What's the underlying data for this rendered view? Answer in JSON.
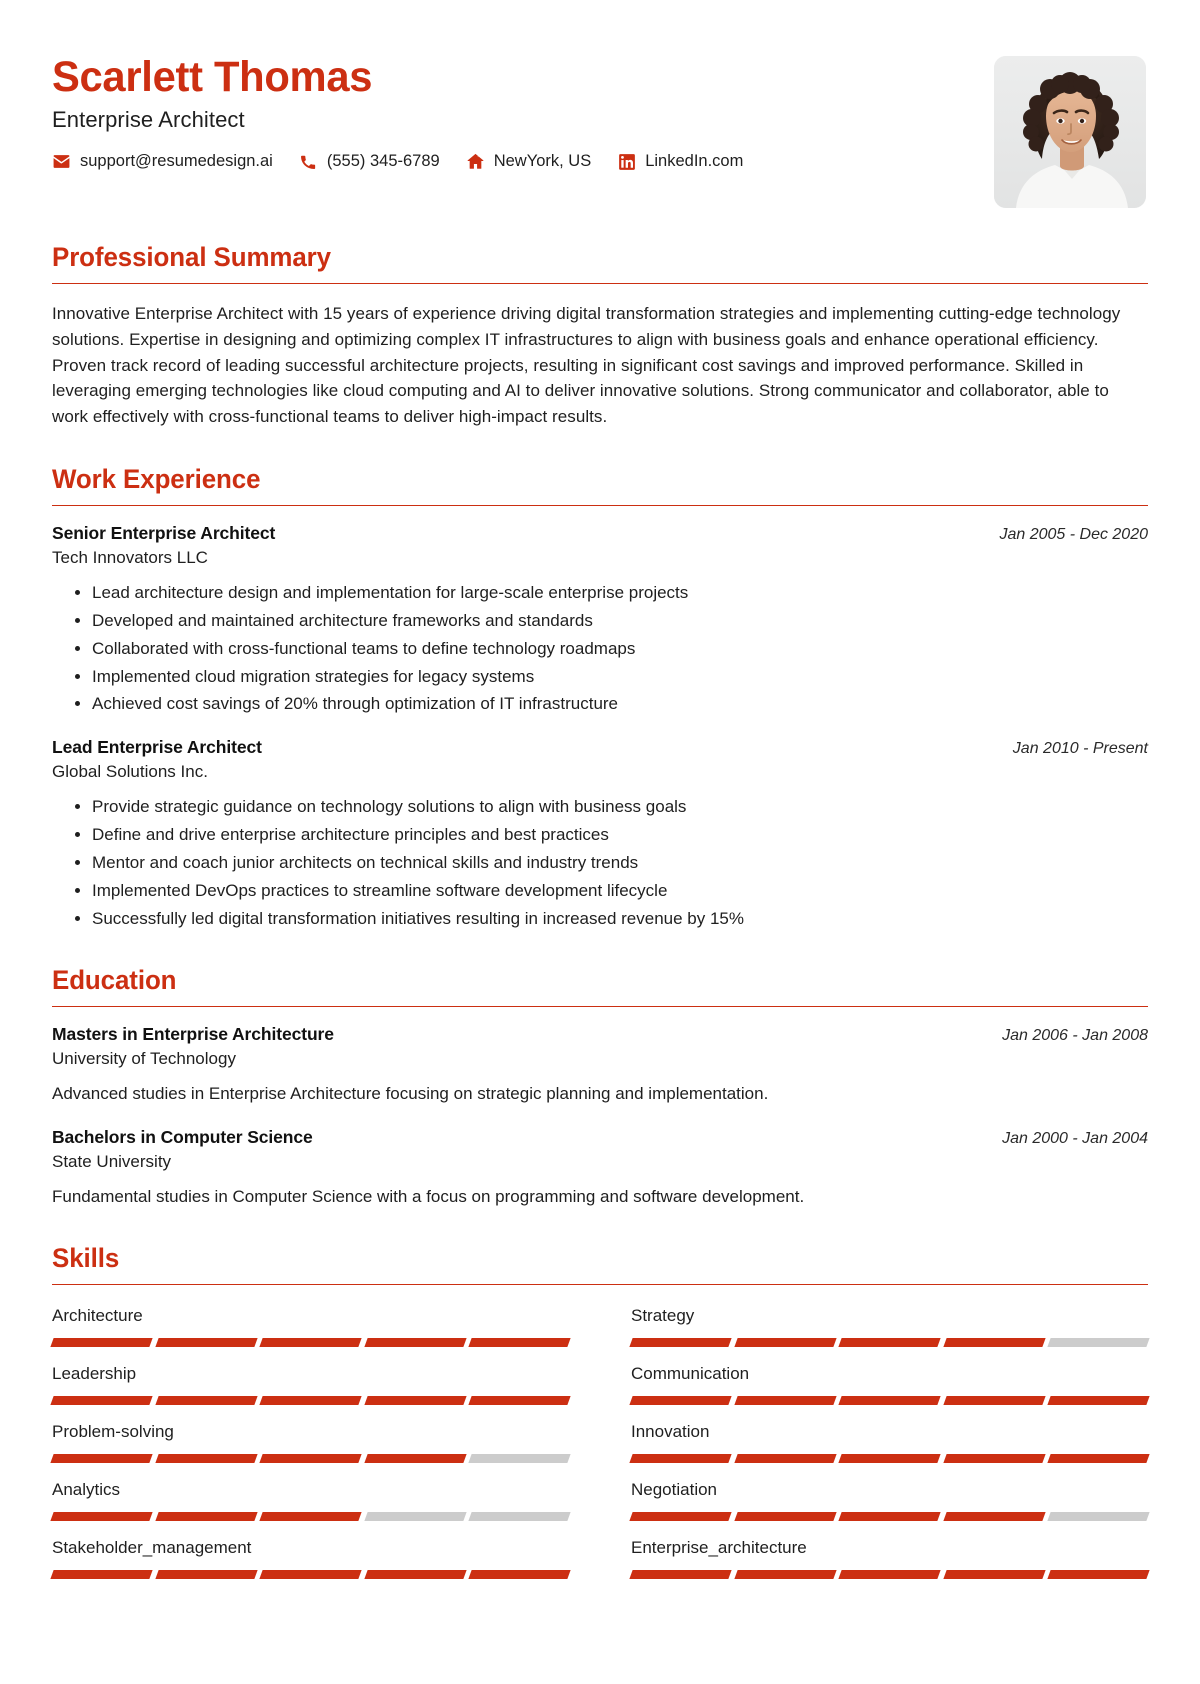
{
  "header": {
    "name": "Scarlett Thomas",
    "job_title": "Enterprise Architect",
    "contacts": [
      {
        "icon": "email-icon",
        "value": "support@resumedesign.ai"
      },
      {
        "icon": "phone-icon",
        "value": "(555) 345-6789"
      },
      {
        "icon": "home-icon",
        "value": "NewYork, US"
      },
      {
        "icon": "linkedin-icon",
        "value": "LinkedIn.com"
      }
    ],
    "photo_alt": "portrait-photo"
  },
  "sections": {
    "summary": {
      "title": "Professional Summary",
      "text": "Innovative Enterprise Architect with 15 years of experience driving digital transformation strategies and implementing cutting-edge technology solutions. Expertise in designing and optimizing complex IT infrastructures to align with business goals and enhance operational efficiency. Proven track record of leading successful architecture projects, resulting in significant cost savings and improved performance. Skilled in leveraging emerging technologies like cloud computing and AI to deliver innovative solutions. Strong communicator and collaborator, able to work effectively with cross-functional teams to deliver high-impact results."
    },
    "experience": {
      "title": "Work Experience",
      "entries": [
        {
          "role": "Senior Enterprise Architect",
          "org": "Tech Innovators LLC",
          "date": "Jan 2005 - Dec 2020",
          "bullets": [
            "Lead architecture design and implementation for large-scale enterprise projects",
            "Developed and maintained architecture frameworks and standards",
            "Collaborated with cross-functional teams to define technology roadmaps",
            "Implemented cloud migration strategies for legacy systems",
            "Achieved cost savings of 20% through optimization of IT infrastructure"
          ]
        },
        {
          "role": "Lead Enterprise Architect",
          "org": "Global Solutions Inc.",
          "date": "Jan 2010 - Present",
          "bullets": [
            "Provide strategic guidance on technology solutions to align with business goals",
            "Define and drive enterprise architecture principles and best practices",
            "Mentor and coach junior architects on technical skills and industry trends",
            "Implemented DevOps practices to streamline software development lifecycle",
            "Successfully led digital transformation initiatives resulting in increased revenue by 15%"
          ]
        }
      ]
    },
    "education": {
      "title": "Education",
      "entries": [
        {
          "role": "Masters in Enterprise Architecture",
          "org": "University of Technology",
          "date": "Jan 2006 - Jan 2008",
          "desc": "Advanced studies in Enterprise Architecture focusing on strategic planning and implementation."
        },
        {
          "role": "Bachelors in Computer Science",
          "org": "State University",
          "date": "Jan 2000 - Jan 2004",
          "desc": "Fundamental studies in Computer Science with a focus on programming and software development."
        }
      ]
    },
    "skills": {
      "title": "Skills",
      "max_level": 5,
      "items": [
        {
          "name": "Architecture",
          "level": 5
        },
        {
          "name": "Strategy",
          "level": 4
        },
        {
          "name": "Leadership",
          "level": 5
        },
        {
          "name": "Communication",
          "level": 5
        },
        {
          "name": "Problem-solving",
          "level": 4
        },
        {
          "name": "Innovation",
          "level": 5
        },
        {
          "name": "Analytics",
          "level": 3
        },
        {
          "name": "Negotiation",
          "level": 4
        },
        {
          "name": "Stakeholder_management",
          "level": 5
        },
        {
          "name": "Enterprise_architecture",
          "level": 5
        }
      ]
    }
  },
  "colors": {
    "accent": "#CC2F12",
    "bar_empty": "#CCCCCC",
    "text": "#1f1f1f"
  }
}
